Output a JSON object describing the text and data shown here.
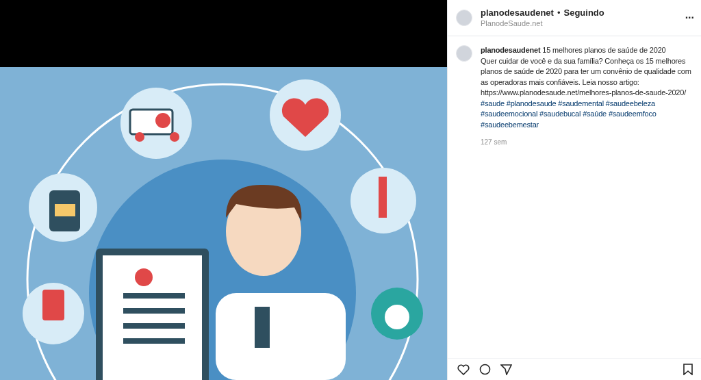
{
  "post_header": {
    "username": "planodesaudenet",
    "separator": "•",
    "follow_status": "Seguindo",
    "location": "PlanodeSaude.net",
    "more": "..."
  },
  "caption": {
    "username": "planodesaudenet",
    "title": "15 melhores planos de saúde de 2020",
    "body": "Quer cuidar de você e da sua família? Conheça os 15 melhores planos de saúde de 2020 para ter um convênio de qualidade com as operadoras mais confiáveis. Leia nosso artigo:",
    "url": "https://www.planodesaude.net/melhores-planos-de-saude-2020/",
    "hashtags": [
      "#saude",
      "#planodesaude",
      "#saudemental",
      "#saudeebeleza",
      "#saudeemocional",
      "#saudebucal",
      "#saúde",
      "#saudeemfoco",
      "#saudeebemestar"
    ],
    "time": "127 sem"
  }
}
